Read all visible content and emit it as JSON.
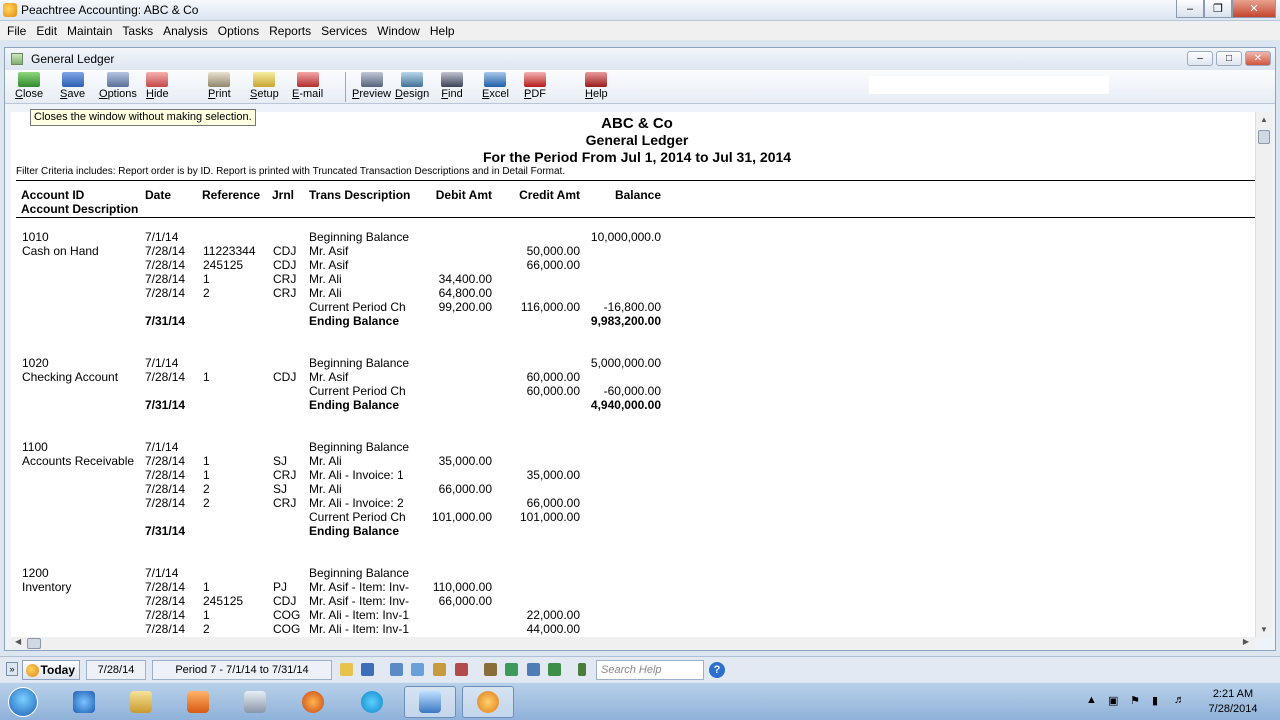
{
  "app": {
    "title": "Peachtree Accounting: ABC & Co"
  },
  "menu": [
    "File",
    "Edit",
    "Maintain",
    "Tasks",
    "Analysis",
    "Options",
    "Reports",
    "Services",
    "Window",
    "Help"
  ],
  "window": {
    "title": "General Ledger"
  },
  "toolbar": {
    "close": "Close",
    "save": "Save",
    "options": "Options",
    "hide": "Hide",
    "print": "Print",
    "setup": "Setup",
    "email": "E-mail",
    "preview": "Preview",
    "design": "Design",
    "find": "Find",
    "excel": "Excel",
    "pdf": "PDF",
    "help": "Help"
  },
  "tooltip": "Closes the window without making selection.",
  "report": {
    "company": "ABC & Co",
    "title": "General Ledger",
    "period": "For the Period From Jul 1, 2014 to Jul 31, 2014",
    "filter": "Filter Criteria includes: Report order is by ID. Report is printed with Truncated Transaction Descriptions and in Detail Format.",
    "headers": {
      "account_id": "Account ID",
      "account_desc": "Account Description",
      "date": "Date",
      "reference": "Reference",
      "jrnl": "Jrnl",
      "trans_desc": "Trans Description",
      "debit": "Debit Amt",
      "credit": "Credit Amt",
      "balance": "Balance"
    },
    "rows": [
      {
        "acct": "1010",
        "date": "7/1/14",
        "ref": "",
        "jrnl": "",
        "desc": "Beginning Balance",
        "debit": "",
        "credit": "",
        "balance": "10,000,000.0",
        "bold": false
      },
      {
        "acct": "Cash on Hand",
        "date": "7/28/14",
        "ref": "11223344",
        "jrnl": "CDJ",
        "desc": "Mr. Asif",
        "debit": "",
        "credit": "50,000.00",
        "balance": "",
        "bold": false
      },
      {
        "acct": "",
        "date": "7/28/14",
        "ref": "245125",
        "jrnl": "CDJ",
        "desc": "Mr. Asif",
        "debit": "",
        "credit": "66,000.00",
        "balance": "",
        "bold": false
      },
      {
        "acct": "",
        "date": "7/28/14",
        "ref": "1",
        "jrnl": "CRJ",
        "desc": "Mr. Ali",
        "debit": "34,400.00",
        "credit": "",
        "balance": "",
        "bold": false
      },
      {
        "acct": "",
        "date": "7/28/14",
        "ref": "2",
        "jrnl": "CRJ",
        "desc": "Mr. Ali",
        "debit": "64,800.00",
        "credit": "",
        "balance": "",
        "bold": false
      },
      {
        "acct": "",
        "date": "",
        "ref": "",
        "jrnl": "",
        "desc": "Current Period Ch",
        "debit": "99,200.00",
        "credit": "116,000.00",
        "balance": "-16,800.00",
        "bold": false
      },
      {
        "acct": "",
        "date": "7/31/14",
        "ref": "",
        "jrnl": "",
        "desc": "Ending Balance",
        "debit": "",
        "credit": "",
        "balance": "9,983,200.00",
        "bold": true
      },
      {
        "acct": "1020",
        "date": "7/1/14",
        "ref": "",
        "jrnl": "",
        "desc": "Beginning Balance",
        "debit": "",
        "credit": "",
        "balance": "5,000,000.00",
        "bold": false
      },
      {
        "acct": "Checking Account",
        "date": "7/28/14",
        "ref": "1",
        "jrnl": "CDJ",
        "desc": "Mr. Asif",
        "debit": "",
        "credit": "60,000.00",
        "balance": "",
        "bold": false
      },
      {
        "acct": "",
        "date": "",
        "ref": "",
        "jrnl": "",
        "desc": "Current Period Ch",
        "debit": "",
        "credit": "60,000.00",
        "balance": "-60,000.00",
        "bold": false
      },
      {
        "acct": "",
        "date": "7/31/14",
        "ref": "",
        "jrnl": "",
        "desc": "Ending Balance",
        "debit": "",
        "credit": "",
        "balance": "4,940,000.00",
        "bold": true
      },
      {
        "acct": "1100",
        "date": "7/1/14",
        "ref": "",
        "jrnl": "",
        "desc": "Beginning Balance",
        "debit": "",
        "credit": "",
        "balance": "",
        "bold": false
      },
      {
        "acct": "Accounts Receivable",
        "date": "7/28/14",
        "ref": "1",
        "jrnl": "SJ",
        "desc": "Mr. Ali",
        "debit": "35,000.00",
        "credit": "",
        "balance": "",
        "bold": false
      },
      {
        "acct": "",
        "date": "7/28/14",
        "ref": "1",
        "jrnl": "CRJ",
        "desc": "Mr. Ali - Invoice: 1",
        "debit": "",
        "credit": "35,000.00",
        "balance": "",
        "bold": false
      },
      {
        "acct": "",
        "date": "7/28/14",
        "ref": "2",
        "jrnl": "SJ",
        "desc": "Mr. Ali",
        "debit": "66,000.00",
        "credit": "",
        "balance": "",
        "bold": false
      },
      {
        "acct": "",
        "date": "7/28/14",
        "ref": "2",
        "jrnl": "CRJ",
        "desc": "Mr. Ali - Invoice: 2",
        "debit": "",
        "credit": "66,000.00",
        "balance": "",
        "bold": false
      },
      {
        "acct": "",
        "date": "",
        "ref": "",
        "jrnl": "",
        "desc": "Current Period Ch",
        "debit": "101,000.00",
        "credit": "101,000.00",
        "balance": "",
        "bold": false
      },
      {
        "acct": "",
        "date": "7/31/14",
        "ref": "",
        "jrnl": "",
        "desc": "Ending Balance",
        "debit": "",
        "credit": "",
        "balance": "",
        "bold": true
      },
      {
        "acct": "1200",
        "date": "7/1/14",
        "ref": "",
        "jrnl": "",
        "desc": "Beginning Balance",
        "debit": "",
        "credit": "",
        "balance": "",
        "bold": false
      },
      {
        "acct": "Inventory",
        "date": "7/28/14",
        "ref": "1",
        "jrnl": "PJ",
        "desc": "Mr. Asif - Item: Inv-",
        "debit": "110,000.00",
        "credit": "",
        "balance": "",
        "bold": false
      },
      {
        "acct": "",
        "date": "7/28/14",
        "ref": "245125",
        "jrnl": "CDJ",
        "desc": "Mr. Asif - Item: Inv-",
        "debit": "66,000.00",
        "credit": "",
        "balance": "",
        "bold": false
      },
      {
        "acct": "",
        "date": "7/28/14",
        "ref": "1",
        "jrnl": "COG",
        "desc": "Mr. Ali - Item: Inv-1",
        "debit": "",
        "credit": "22,000.00",
        "balance": "",
        "bold": false
      },
      {
        "acct": "",
        "date": "7/28/14",
        "ref": "2",
        "jrnl": "COG",
        "desc": "Mr. Ali - Item: Inv-1",
        "debit": "",
        "credit": "44,000.00",
        "balance": "",
        "bold": false
      }
    ]
  },
  "statusbar": {
    "today": "Today",
    "date": "7/28/14",
    "period": "Period 7 - 7/1/14 to 7/31/14",
    "search_placeholder": "Search Help",
    "help_icon": "?"
  },
  "taskbar": {
    "time": "2:21 AM",
    "date": "7/28/2014"
  }
}
